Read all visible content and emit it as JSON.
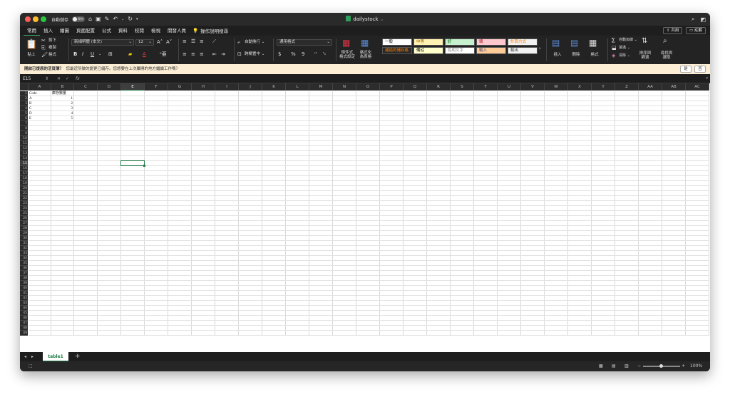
{
  "titlebar": {
    "autosave_label": "自動儲存",
    "autosave_state": "關閉",
    "title": "dailystock"
  },
  "tabs": [
    "常用",
    "插入",
    "繪圖",
    "頁面配置",
    "公式",
    "資料",
    "校閱",
    "檢視",
    "開發人員"
  ],
  "tell_me": "操作說明搜尋",
  "share_label": "共用",
  "comments_label": "註解",
  "ribbon": {
    "paste": "貼上",
    "cut": "剪下",
    "copy": "複製",
    "format_painter": "格式",
    "font_name": "新細明體 (本文)",
    "font_size": "12",
    "bold": "B",
    "italic": "I",
    "underline": "U",
    "wrap_text": "自動換行",
    "merge_center": "跨欄置中",
    "number_format": "通用格式",
    "currency": "$",
    "percent": "%",
    "comma": "9",
    "conditional_format": [
      "條件式",
      "格式設定"
    ],
    "format_as_table": [
      "格式化",
      "為表格"
    ],
    "styles": [
      {
        "name": "一般",
        "bg": "#ffffff",
        "fg": "#000000"
      },
      {
        "name": "中等",
        "bg": "#fff2b3",
        "fg": "#9c6500"
      },
      {
        "name": "好",
        "bg": "#c6efce",
        "fg": "#006100"
      },
      {
        "name": "壞",
        "bg": "#ffc7ce",
        "fg": "#9c0006"
      },
      {
        "name": "計算方式",
        "bg": "#f2f2f2",
        "fg": "#fa7d00"
      },
      {
        "name": "連結的儲存格",
        "bg": "#2a2a2a",
        "fg": "#fa7d00"
      },
      {
        "name": "備註",
        "bg": "#ffffcc",
        "fg": "#000000"
      },
      {
        "name": "說明文字",
        "bg": "#ffffff",
        "fg": "#7f7f7f"
      },
      {
        "name": "輸入",
        "bg": "#ffcc99",
        "fg": "#3f3f76"
      },
      {
        "name": "輸出",
        "bg": "#f2f2f2",
        "fg": "#3f3f3f"
      }
    ],
    "insert": "插入",
    "delete": "刪除",
    "format": "格式",
    "autosum": "自動加總",
    "fill": "填滿",
    "clear": "清除",
    "sort_filter": [
      "排序與",
      "篩選"
    ],
    "find_select": [
      "尋找與",
      "選取"
    ]
  },
  "infobar": {
    "title": "開啟已復原的活頁簿？",
    "message": "您最近所做的變更已儲存。您想要在上次離開的地方繼續工作嗎？",
    "yes": "是",
    "no": "否"
  },
  "formula_bar": {
    "name_box": "E15",
    "fx": "fx",
    "value": ""
  },
  "grid": {
    "columns": [
      "A",
      "B",
      "C",
      "D",
      "E",
      "F",
      "G",
      "H",
      "I",
      "J",
      "K",
      "L",
      "M",
      "N",
      "O",
      "P",
      "Q",
      "R",
      "S",
      "T",
      "U",
      "V",
      "W",
      "X",
      "Y",
      "Z",
      "AA",
      "AB",
      "AC"
    ],
    "row_count": 49,
    "selected_cell": "E15",
    "cells": [
      {
        "ref": "A1",
        "value": "Code"
      },
      {
        "ref": "B1",
        "value": "庫存數量"
      },
      {
        "ref": "A2",
        "value": "A"
      },
      {
        "ref": "B2",
        "value": "1"
      },
      {
        "ref": "A3",
        "value": "B"
      },
      {
        "ref": "B3",
        "value": "2"
      },
      {
        "ref": "A4",
        "value": "C"
      },
      {
        "ref": "B4",
        "value": "3"
      },
      {
        "ref": "A5",
        "value": "D"
      },
      {
        "ref": "B5",
        "value": "4"
      },
      {
        "ref": "A6",
        "value": "E"
      },
      {
        "ref": "B6",
        "value": "5"
      }
    ]
  },
  "sheets": [
    "table1"
  ],
  "status": {
    "zoom": "100%"
  }
}
